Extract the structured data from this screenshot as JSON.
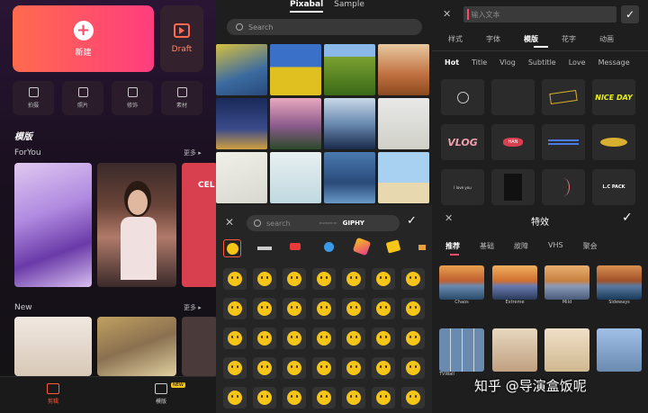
{
  "home": {
    "new_label": "新建",
    "draft_label": "Draft",
    "tools": [
      "拍摄",
      "照片",
      "修饰",
      "素材"
    ],
    "templates_title": "模版",
    "foryou_label": "ForYou",
    "more1": "更多 ▸",
    "thumb3_text": "CEL",
    "new_section": "New",
    "more2": "更多 ▸",
    "nav": [
      "剪辑",
      "模版"
    ],
    "nav_badge": "NEW"
  },
  "media": {
    "tab_pixabay": "Pixabal",
    "tab_sample": "Sample",
    "search_placeholder": "Search"
  },
  "sticker": {
    "search_placeholder": "search",
    "powered": "POWERED BY",
    "giphy": "GIPHY"
  },
  "text_panel": {
    "input_placeholder": "输入文本",
    "tabs": [
      "样式",
      "字体",
      "模版",
      "花字",
      "动画"
    ],
    "active_tab": "模版",
    "subtabs": [
      "Hot",
      "Title",
      "Vlog",
      "Subtitle",
      "Love",
      "Message"
    ],
    "active_subtab": "Hot",
    "tile_texts": [
      "NICE DAY",
      "VLOG",
      "HAN",
      "I love you",
      "L.C PACK"
    ]
  },
  "effects": {
    "title": "特效",
    "tabs": [
      "推荐",
      "基础",
      "故障",
      "VHS",
      "聚会"
    ],
    "active_tab": "推荐",
    "items": [
      "Chaos",
      "Extreme",
      "Mild",
      "Sideways",
      "TVWall"
    ]
  },
  "watermark": "知乎 @导演盒饭呢",
  "colors": {
    "accent": "#ff4a6a",
    "brand_yellow": "#f5c518"
  }
}
